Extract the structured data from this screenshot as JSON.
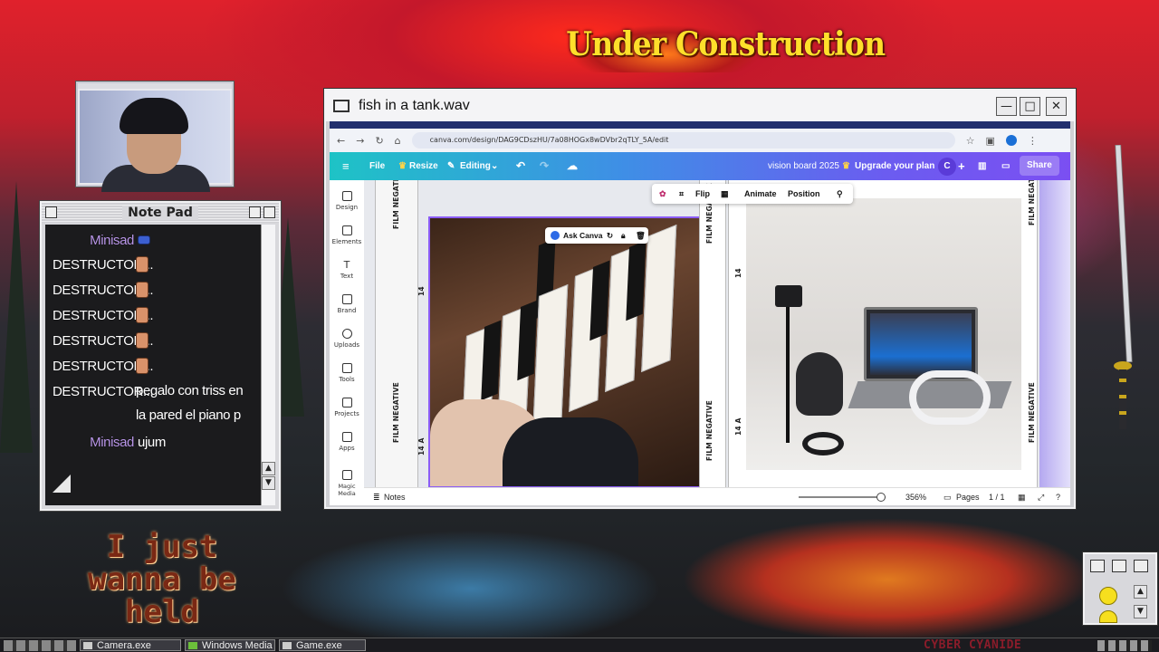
{
  "desktop": {
    "banner_text": "Under Construction",
    "overlay_text": "I just wanna be held",
    "brand_text": "CYBER CYANIDE"
  },
  "notepad": {
    "title": "Note Pad",
    "messages": [
      {
        "user": "Minisad",
        "text": ""
      },
      {
        "user": "DESTRUCTOR...",
        "text": ""
      },
      {
        "user": "DESTRUCTOR...",
        "text": ""
      },
      {
        "user": "DESTRUCTOR...",
        "text": ""
      },
      {
        "user": "DESTRUCTOR...",
        "text": ""
      },
      {
        "user": "DESTRUCTOR...",
        "text": ""
      },
      {
        "user": "DESTRUCTOR...",
        "text": "pegalo con triss en la pared el piano p"
      },
      {
        "user": "Minisad",
        "text": "ujum"
      }
    ]
  },
  "window": {
    "title": "fish in a tank.wav",
    "minimize_glyph": "—",
    "maximize_glyph": "□",
    "close_glyph": "✕"
  },
  "browser": {
    "url": "canva.com/design/DAG9CDszHU/7a08HOGx8wDVbr2qTLY_5A/edit"
  },
  "canva": {
    "menu": {
      "file": "File",
      "resize": "Resize",
      "editing": "Editing",
      "design_title": "vision board 2025",
      "upgrade": "Upgrade your plan",
      "avatar": "C",
      "share": "Share"
    },
    "sidebar": [
      "Design",
      "Elements",
      "Text",
      "Brand",
      "Uploads",
      "Tools",
      "Projects",
      "Apps",
      "Magic Media"
    ],
    "toolbar": {
      "flip": "Flip",
      "animate": "Animate",
      "position": "Position"
    },
    "ask_canva": "Ask Canva",
    "film_label": "FILM NEGATIVE",
    "film_frame_a": "14 A",
    "film_frame": "14",
    "bottom": {
      "notes": "Notes",
      "zoom": "356%",
      "pages": "Pages",
      "page_count": "1 / 1"
    }
  },
  "taskbar": {
    "items": [
      "Camera.exe",
      "Windows Media Pla",
      "Game.exe"
    ]
  },
  "colors": {
    "canva_gradient_start": "#1ec3c6",
    "canva_gradient_end": "#7b4ff2",
    "selection": "#8b5cf6",
    "chat_minisad": "#b996e8"
  }
}
